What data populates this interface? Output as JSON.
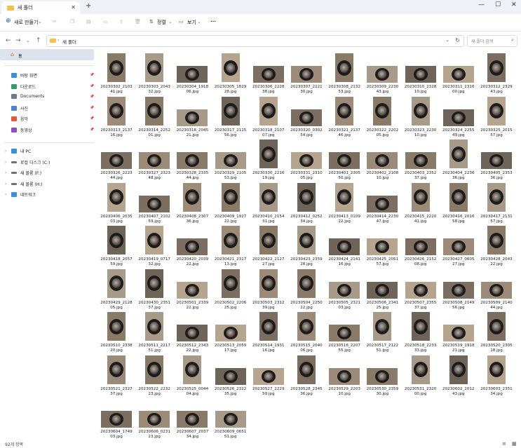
{
  "window": {
    "tab_title": "새 폴더",
    "new_tab": "+",
    "controls": [
      "—",
      "☐",
      "✕"
    ]
  },
  "toolbar": {
    "new_label": "새로 만들기",
    "sort_label": "정렬",
    "view_label": "보기",
    "more_label": "···"
  },
  "address": {
    "crumb": "새 폴더",
    "search_placeholder": "새 폴더 검색"
  },
  "sidebar": {
    "home": "홈",
    "quick": [
      {
        "label": "바탕 화면",
        "color": "#3a8fd8"
      },
      {
        "label": "다운로드",
        "color": "#2f9e6a"
      },
      {
        "label": "Documents",
        "color": "#6b7b8c"
      },
      {
        "label": "사진",
        "color": "#4e7fd6"
      },
      {
        "label": "음악",
        "color": "#e25a3c"
      },
      {
        "label": "동영상",
        "color": "#8a4fc2"
      }
    ],
    "drives": [
      {
        "label": "내 PC",
        "color": "#3a8fd8"
      },
      {
        "label": "로컬 디스크 (C:)",
        "color": "#707070"
      },
      {
        "label": "새 볼륨 (F:)",
        "color": "#707070"
      },
      {
        "label": "새 볼륨 (H:)",
        "color": "#707070"
      },
      {
        "label": "네트워크",
        "color": "#3a8fd8"
      }
    ]
  },
  "files": [
    {
      "l1": "20230302_2103",
      "l2": "41.jpg",
      "o": "p"
    },
    {
      "l1": "20230303_2043",
      "l2": "32.jpg",
      "o": "p"
    },
    {
      "l1": "20230304_1918",
      "l2": "06.jpg",
      "o": "l"
    },
    {
      "l1": "20230305_1829",
      "l2": "28.jpg",
      "o": "p"
    },
    {
      "l1": "20230306_2228",
      "l2": "38.jpg",
      "o": "l"
    },
    {
      "l1": "20230307_2221",
      "l2": "30.jpg",
      "o": "l"
    },
    {
      "l1": "20230308_2132",
      "l2": "53.jpg",
      "o": "p"
    },
    {
      "l1": "20230309_2230",
      "l2": "43.jpg",
      "o": "l"
    },
    {
      "l1": "20230310_2328",
      "l2": "10.jpg",
      "o": "l"
    },
    {
      "l1": "20230311_2316",
      "l2": "00.jpg",
      "o": "l"
    },
    {
      "l1": "20230312_2329",
      "l2": "43.jpg",
      "o": "p"
    },
    {
      "l1": "20230313_2137",
      "l2": "16.jpg",
      "o": "p"
    },
    {
      "l1": "20230314_2252",
      "l2": "01.jpg",
      "o": "p"
    },
    {
      "l1": "20230316_2045",
      "l2": "21.jpg",
      "o": "l"
    },
    {
      "l1": "20230317_2115",
      "l2": "56.jpg",
      "o": "p"
    },
    {
      "l1": "20230318_2107",
      "l2": "07.jpg",
      "o": "p"
    },
    {
      "l1": "20230320_0302",
      "l2": "54.jpg",
      "o": "l"
    },
    {
      "l1": "20230321_2137",
      "l2": "46.jpg",
      "o": "p"
    },
    {
      "l1": "20230322_2202",
      "l2": "05.jpg",
      "o": "p"
    },
    {
      "l1": "20230323_2230",
      "l2": "10.jpg",
      "o": "p"
    },
    {
      "l1": "20230324_2255",
      "l2": "49.jpg",
      "o": "l"
    },
    {
      "l1": "20230325_2015",
      "l2": "57.jpg",
      "o": "p"
    },
    {
      "l1": "20230326_2223",
      "l2": "44.jpg",
      "o": "l"
    },
    {
      "l1": "20230327_2323",
      "l2": "48.jpg",
      "o": "l"
    },
    {
      "l1": "20230328_2335",
      "l2": "44.jpg",
      "o": "l"
    },
    {
      "l1": "20230329_2105",
      "l2": "53.jpg",
      "o": "l"
    },
    {
      "l1": "20230330_2216",
      "l2": "19.jpg",
      "o": "p"
    },
    {
      "l1": "20230331_2310",
      "l2": "05.jpg",
      "o": "l"
    },
    {
      "l1": "20230401_2305",
      "l2": "50.jpg",
      "o": "l"
    },
    {
      "l1": "20230402_2108",
      "l2": "10.jpg",
      "o": "l"
    },
    {
      "l1": "20230403_2352",
      "l2": "37.jpg",
      "o": "l"
    },
    {
      "l1": "20230404_2236",
      "l2": "36.jpg",
      "o": "p"
    },
    {
      "l1": "20230405_2353",
      "l2": "36.jpg",
      "o": "l"
    },
    {
      "l1": "20230406_2035",
      "l2": "03.jpg",
      "o": "p"
    },
    {
      "l1": "20230407_2102",
      "l2": "59.jpg",
      "o": "l"
    },
    {
      "l1": "20230408_2307",
      "l2": "36.jpg",
      "o": "p"
    },
    {
      "l1": "20230409_1927",
      "l2": "22.jpg",
      "o": "p"
    },
    {
      "l1": "20230410_2154",
      "l2": "31.jpg",
      "o": "p"
    },
    {
      "l1": "20230412_0252",
      "l2": "34.jpg",
      "o": "p"
    },
    {
      "l1": "20230413_0109",
      "l2": "22.jpg",
      "o": "p"
    },
    {
      "l1": "20230414_2230",
      "l2": "47.jpg",
      "o": "l"
    },
    {
      "l1": "20230415_2220",
      "l2": "41.jpg",
      "o": "p"
    },
    {
      "l1": "20230416_2016",
      "l2": "58.jpg",
      "o": "p"
    },
    {
      "l1": "20230417_2131",
      "l2": "57.jpg",
      "o": "p"
    },
    {
      "l1": "20230418_2057",
      "l2": "59.jpg",
      "o": "p"
    },
    {
      "l1": "20230419_0717",
      "l2": "32.jpg",
      "o": "p"
    },
    {
      "l1": "20230420_2039",
      "l2": "22.jpg",
      "o": "l"
    },
    {
      "l1": "20230421_2317",
      "l2": "13.jpg",
      "o": "p"
    },
    {
      "l1": "20230422_2127",
      "l2": "27.jpg",
      "o": "p"
    },
    {
      "l1": "20230423_2359",
      "l2": "28.jpg",
      "o": "p"
    },
    {
      "l1": "20230424_2141",
      "l2": "16.jpg",
      "o": "l"
    },
    {
      "l1": "20230425_2051",
      "l2": "57.jpg",
      "o": "l"
    },
    {
      "l1": "20230426_2152",
      "l2": "08.jpg",
      "o": "l"
    },
    {
      "l1": "20230427_0605",
      "l2": "27.jpg",
      "o": "l"
    },
    {
      "l1": "20230428_2043",
      "l2": "22.jpg",
      "o": "p"
    },
    {
      "l1": "20230429_2128",
      "l2": "05.jpg",
      "o": "p"
    },
    {
      "l1": "20230430_2351",
      "l2": "37.jpg",
      "o": "p"
    },
    {
      "l1": "20230501_2339",
      "l2": "22.jpg",
      "o": "l"
    },
    {
      "l1": "20230502_2206",
      "l2": "25.jpg",
      "o": "p"
    },
    {
      "l1": "20230503_2312",
      "l2": "39.jpg",
      "o": "p"
    },
    {
      "l1": "20230504_2250",
      "l2": "22.jpg",
      "o": "p"
    },
    {
      "l1": "20230505_2321",
      "l2": "03.jpg",
      "o": "l"
    },
    {
      "l1": "20230506_2341",
      "l2": "25.jpg",
      "o": "l"
    },
    {
      "l1": "20230507_2355",
      "l2": "37.jpg",
      "o": "l"
    },
    {
      "l1": "20230508_2149",
      "l2": "56.jpg",
      "o": "l"
    },
    {
      "l1": "20230509_2140",
      "l2": "44.jpg",
      "o": "l"
    },
    {
      "l1": "20230510_2338",
      "l2": "20.jpg",
      "o": "p"
    },
    {
      "l1": "20230511_2217",
      "l2": "51.jpg",
      "o": "p"
    },
    {
      "l1": "20230512_2343",
      "l2": "22.jpg",
      "o": "l"
    },
    {
      "l1": "20230513_2059",
      "l2": "17.jpg",
      "o": "l"
    },
    {
      "l1": "20230514_1931",
      "l2": "16.jpg",
      "o": "p"
    },
    {
      "l1": "20230515_2040",
      "l2": "06.jpg",
      "o": "p"
    },
    {
      "l1": "20230516_2207",
      "l2": "55.jpg",
      "o": "l"
    },
    {
      "l1": "20230517_2122",
      "l2": "51.jpg",
      "o": "p"
    },
    {
      "l1": "20230518_2233",
      "l2": "33.jpg",
      "o": "p"
    },
    {
      "l1": "20230519_1918",
      "l2": "21.jpg",
      "o": "l"
    },
    {
      "l1": "20230520_2305",
      "l2": "18.jpg",
      "o": "p"
    },
    {
      "l1": "20230521_2327",
      "l2": "37.jpg",
      "o": "p"
    },
    {
      "l1": "20230522_2232",
      "l2": "23.jpg",
      "o": "p"
    },
    {
      "l1": "20230525_0044",
      "l2": "04.jpg",
      "o": "p"
    },
    {
      "l1": "20230526_2322",
      "l2": "35.jpg",
      "o": "l"
    },
    {
      "l1": "20230527_2229",
      "l2": "59.jpg",
      "o": "l"
    },
    {
      "l1": "20230528_2345",
      "l2": "36.jpg",
      "o": "p"
    },
    {
      "l1": "20230529_2203",
      "l2": "10.jpg",
      "o": "l"
    },
    {
      "l1": "20230530_2359",
      "l2": "30.jpg",
      "o": "l"
    },
    {
      "l1": "20230531_2320",
      "l2": "00.jpg",
      "o": "p"
    },
    {
      "l1": "20230602_2012",
      "l2": "43.jpg",
      "o": "p"
    },
    {
      "l1": "20230603_2351",
      "l2": "34.jpg",
      "o": "p"
    },
    {
      "l1": "20230604_1749",
      "l2": "03.jpg",
      "o": "l"
    },
    {
      "l1": "20230606_0231",
      "l2": "23.jpg",
      "o": "l"
    },
    {
      "l1": "20230607_2037",
      "l2": "34.jpg",
      "o": "l"
    },
    {
      "l1": "20230609_0651",
      "l2": "51.jpg",
      "o": "l"
    }
  ],
  "status": {
    "count": "92개 항목"
  }
}
